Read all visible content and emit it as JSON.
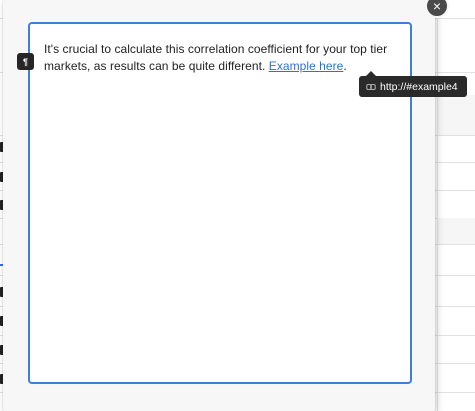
{
  "modal": {
    "close_label": "×",
    "editor": {
      "text_before_link": "It's crucial to calculate this correlation coefficient for your top tier markets, as results can be quite different. ",
      "link_text": "Example here",
      "text_after_link": "."
    }
  },
  "paragraph_marker": {
    "glyph": "¶",
    "icon": "paragraph-icon"
  },
  "link_tooltip": {
    "url": "http://#example4",
    "icon": "link-icon"
  },
  "colors": {
    "accent": "#3f7fdc",
    "link": "#2a72d4",
    "tooltip_bg": "#2a2a2a"
  }
}
